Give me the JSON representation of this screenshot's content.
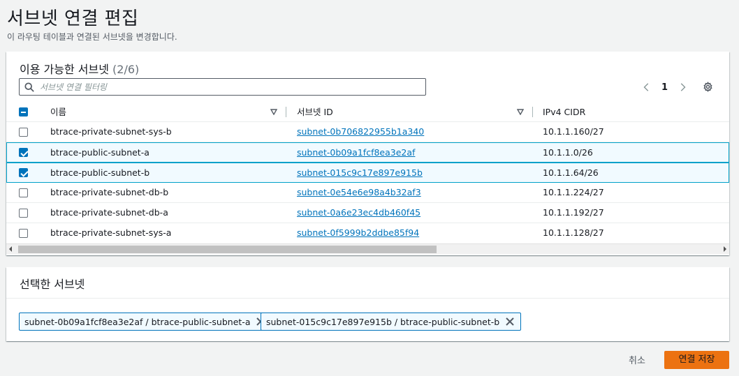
{
  "page": {
    "title": "서브넷 연결 편집",
    "description": "이 라우팅 테이블과 연결된 서브넷을 변경합니다."
  },
  "available": {
    "title": "이용 가능한 서브넷",
    "count": "(2/6)",
    "filter_placeholder": "서브넷 연결 필터링",
    "page_number": "1",
    "columns": [
      "이름",
      "서브넷 ID",
      "IPv4 CIDR"
    ],
    "rows": [
      {
        "name": "btrace-private-subnet-sys-b",
        "subnet_id": "subnet-0b706822955b1a340",
        "cidr": "10.1.1.160/27",
        "checked": false
      },
      {
        "name": "btrace-public-subnet-a",
        "subnet_id": "subnet-0b09a1fcf8ea3e2af",
        "cidr": "10.1.1.0/26",
        "checked": true
      },
      {
        "name": "btrace-public-subnet-b",
        "subnet_id": "subnet-015c9c17e897e915b",
        "cidr": "10.1.1.64/26",
        "checked": true
      },
      {
        "name": "btrace-private-subnet-db-b",
        "subnet_id": "subnet-0e54e6e98a4b32af3",
        "cidr": "10.1.1.224/27",
        "checked": false
      },
      {
        "name": "btrace-private-subnet-db-a",
        "subnet_id": "subnet-0a6e23ec4db460f45",
        "cidr": "10.1.1.192/27",
        "checked": false
      },
      {
        "name": "btrace-private-subnet-sys-a",
        "subnet_id": "subnet-0f5999b2ddbe85f94",
        "cidr": "10.1.1.128/27",
        "checked": false
      }
    ]
  },
  "selected": {
    "title": "선택한 서브넷",
    "tokens": [
      {
        "label": "subnet-0b09a1fcf8ea3e2af / btrace-public-subnet-a"
      },
      {
        "label": "subnet-015c9c17e897e915b / btrace-public-subnet-b"
      }
    ]
  },
  "footer": {
    "cancel_label": "취소",
    "save_label": "연결 저장"
  },
  "colors": {
    "primary_button": "#ec7211",
    "link": "#0073bb",
    "selection": "#0073bb"
  },
  "icons": [
    "search-icon",
    "chevron-left-icon",
    "chevron-right-icon",
    "gear-icon",
    "sort-down-icon",
    "close-icon"
  ]
}
